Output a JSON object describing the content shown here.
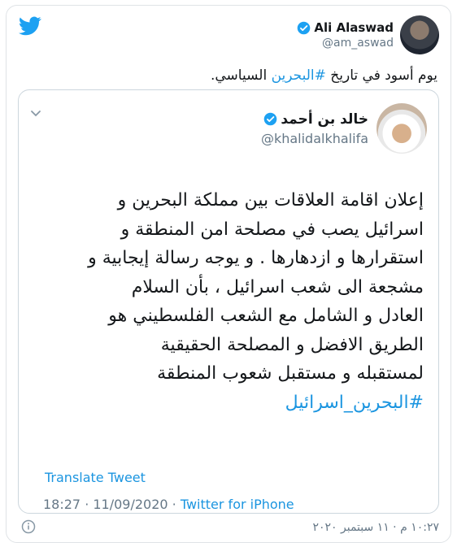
{
  "author": {
    "display_name": "Ali Alaswad",
    "handle": "@am_aswad"
  },
  "tweet": {
    "text_before": "يوم أسود في تاريخ ",
    "hashtag": "#البحرين",
    "text_after": " السياسي."
  },
  "quoted": {
    "display_name": "خالد بن أحمد",
    "handle": "@khalidalkhalifa",
    "lines": [
      "إعلان اقامة العلاقات بين مملكة البحرين و",
      "اسرائيل يصب في مصلحة امن المنطقة و",
      "استقرارها و ازدهارها . و يوجه  رسالة إيجابية و",
      "مشجعة الى شعب اسرائيل ، بأن السلام",
      "العادل و الشامل مع الشعب الفلسطيني هو",
      "الطريق الافضل و المصلحة الحقيقية",
      "لمستقبله و مستقبل  شعوب المنطقة"
    ],
    "hashtag": "#البحرين_اسرائيل",
    "translate_label": "Translate Tweet",
    "time": "18:27 · 11/09/2020 · ",
    "source": "Twitter for iPhone"
  },
  "footer": {
    "date": "١٠:٢٧ م · ١١ سبتمبر ٢٠٢٠"
  },
  "colors": {
    "link": "#1b95e0",
    "muted": "#657786",
    "text": "#14171a",
    "twitter_blue": "#1da1f2"
  },
  "icons": [
    "twitter-logo-icon",
    "verified-badge-icon",
    "chevron-down-icon",
    "info-icon"
  ]
}
